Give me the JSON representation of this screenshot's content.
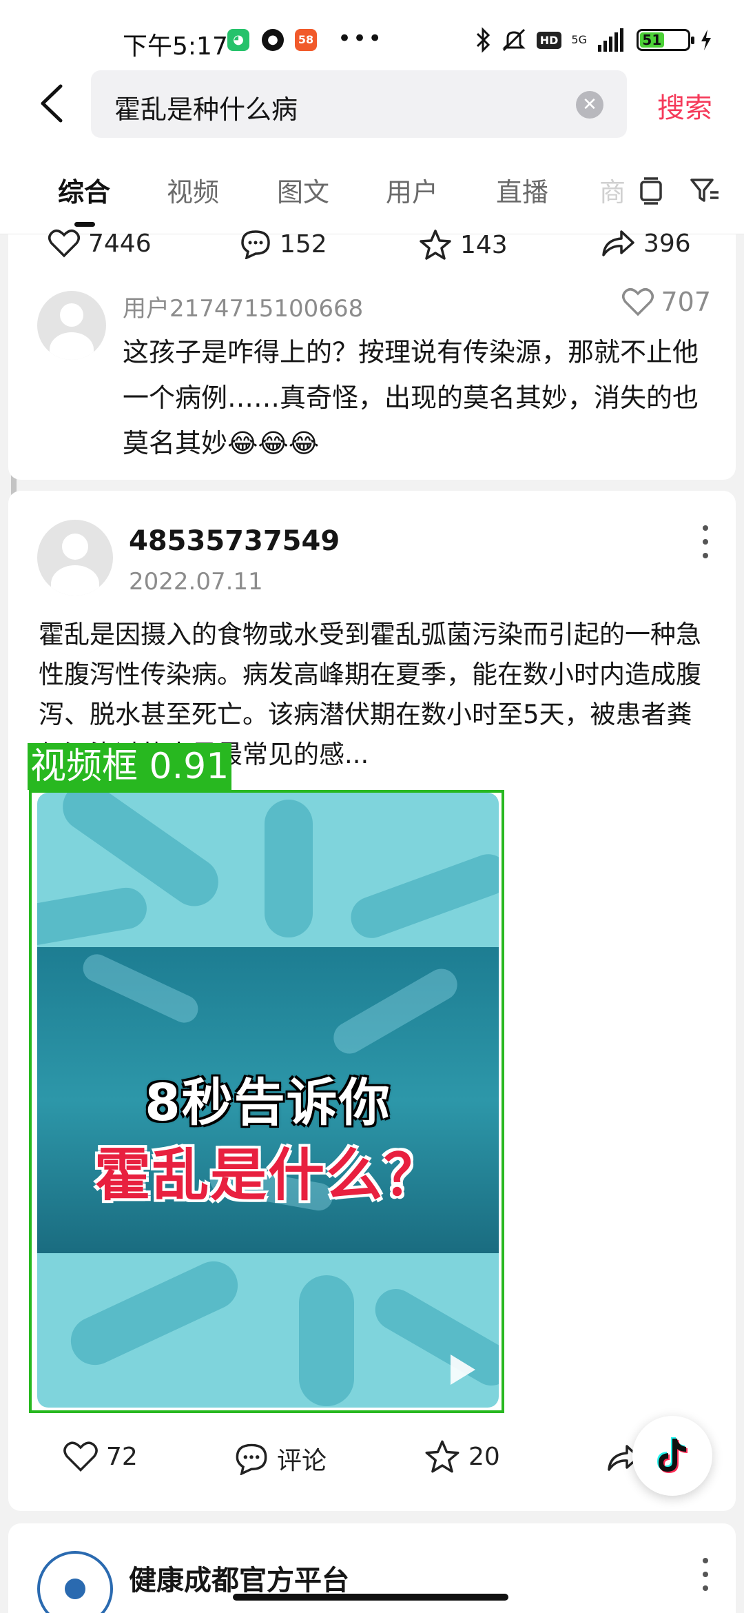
{
  "status_bar": {
    "time": "下午5:17",
    "apps": [
      "wechat-icon",
      "qq-icon",
      "58-icon"
    ],
    "overflow": "•••",
    "hd": "HD",
    "network": "5G",
    "battery": "51",
    "icons": [
      "bluetooth-icon",
      "mute-icon",
      "signal-icon",
      "charging-icon"
    ]
  },
  "search": {
    "query": "霍乱是种什么病",
    "button_label": "搜索"
  },
  "tabs": [
    {
      "label": "综合",
      "active": true
    },
    {
      "label": "视频",
      "active": false
    },
    {
      "label": "图文",
      "active": false
    },
    {
      "label": "用户",
      "active": false
    },
    {
      "label": "直播",
      "active": false
    }
  ],
  "tabs_overflow": "商",
  "prev_post": {
    "likes": "7446",
    "comments": "152",
    "favorites": "143",
    "shares": "396"
  },
  "top_comment": {
    "user": "用户2174715100668",
    "likes": "707",
    "text": "这孩子是咋得上的？按理说有传染源，那就不止他一个病例……真奇怪，出现的莫名其妙，消失的也莫名其妙😂😂😂"
  },
  "post": {
    "author": "48535737549",
    "date": "2022.07.11",
    "text": "霍乱是因摄入的食物或水受到霍乱弧菌污染而引起的一种急性腹泻性传染病。病发高峰期在夏季，能在数小时内造成腹泻、脱水甚至死亡。该病潜伏期在数小时至5天，被患者粪便污染过的水是最常见的感...",
    "detection_label": "视频框 0.91",
    "video_title_line1": "8秒告诉你",
    "video_title_line2": "霍乱是什么？",
    "likes": "72",
    "comment_label": "评论",
    "favorites": "20"
  },
  "next_post": {
    "author": "健康成都官方平台"
  },
  "colors": {
    "accent": "#f53a5a",
    "detection_green": "#28b820"
  }
}
